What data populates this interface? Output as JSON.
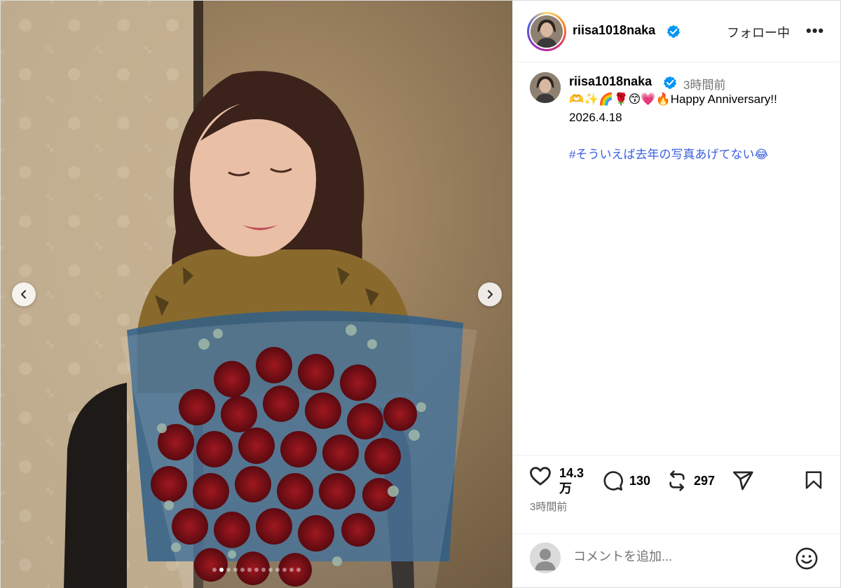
{
  "post": {
    "username": "riisa1018naka",
    "follow_label": "フォロー中",
    "more_label": "•••",
    "caption": {
      "username": "riisa1018naka",
      "time": "3時間前",
      "line1": "🫶✨🌈🌹😙💗🔥Happy Anniversary!!",
      "line2": "2026.4.18",
      "hashtag": "#そういえば去年の写真あげてない😂"
    },
    "stats": {
      "likes": "14.3万",
      "comments": "130",
      "reposts": "297"
    },
    "posted_ago": "3時間前",
    "comment_placeholder": "コメントを追加..."
  },
  "carousel": {
    "total": 13,
    "active_index": 1
  },
  "colors": {
    "verified": "#0095f6",
    "hashtag": "#3b5fe0",
    "muted": "#737373"
  },
  "icons": [
    "chevron-left-icon",
    "chevron-right-icon",
    "verified-icon",
    "heart-icon",
    "comment-icon",
    "repost-icon",
    "share-icon",
    "bookmark-icon",
    "emoji-icon",
    "user-placeholder-icon"
  ]
}
